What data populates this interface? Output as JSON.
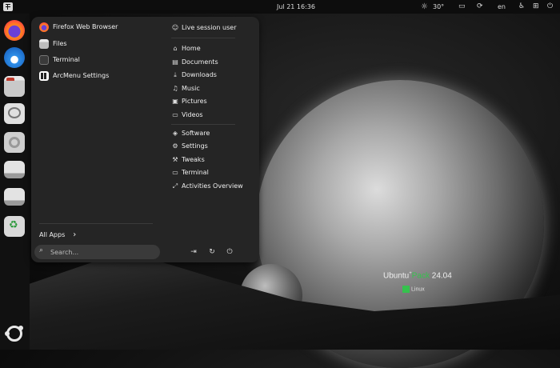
{
  "topbar": {
    "clock": "Jul 21  16:36",
    "weather_temp": "30°",
    "language": "en",
    "icons": [
      "menu-grid-icon",
      "weather-sun-icon",
      "screen-icon",
      "update-icon",
      "accessibility-icon",
      "network-icon",
      "power-icon"
    ]
  },
  "dock": {
    "items": [
      "firefox",
      "thunderbird",
      "files",
      "chat",
      "disc",
      "drive",
      "drive",
      "trash",
      "ubuntu-logo"
    ]
  },
  "menu": {
    "apps": [
      {
        "label": "Firefox Web Browser",
        "icon": "firefox-icon"
      },
      {
        "label": "Files",
        "icon": "files-icon"
      },
      {
        "label": "Terminal",
        "icon": "terminal-icon"
      },
      {
        "label": "ArcMenu Settings",
        "icon": "arcmenu-icon"
      }
    ],
    "all_apps": "All Apps",
    "search_placeholder": "Search...",
    "user": "Live session user",
    "places": [
      {
        "label": "Home",
        "icon": "⌂"
      },
      {
        "label": "Documents",
        "icon": "▤"
      },
      {
        "label": "Downloads",
        "icon": "⤓"
      },
      {
        "label": "Music",
        "icon": "♫"
      },
      {
        "label": "Pictures",
        "icon": "▣"
      },
      {
        "label": "Videos",
        "icon": "▭"
      }
    ],
    "system": [
      {
        "label": "Software",
        "icon": "◈"
      },
      {
        "label": "Settings",
        "icon": "⚙"
      },
      {
        "label": "Tweaks",
        "icon": "⚒"
      },
      {
        "label": "Terminal",
        "icon": "▭"
      },
      {
        "label": "Activities Overview",
        "icon": "⤢"
      }
    ]
  },
  "wallpaper": {
    "brand_main": "Ubuntu",
    "brand_accent": "Pack",
    "brand_version": " 24.04",
    "brand_sub": "Linux"
  },
  "colors": {
    "accent": "#35c24d",
    "menu_bg": "#252525",
    "topbar_bg": "#0d0d0d"
  }
}
